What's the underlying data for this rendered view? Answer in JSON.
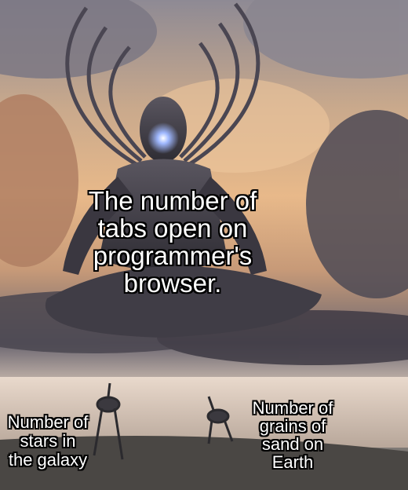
{
  "captions": {
    "main": [
      "The number of",
      "tabs open on",
      "programmer's",
      "browser."
    ],
    "left": [
      "Number of",
      "stars in",
      "the galaxy"
    ],
    "right": [
      "Number of",
      "grains of",
      "sand on",
      "Earth"
    ]
  },
  "colors": {
    "caption_text": "#ffffff",
    "caption_outline": "#000000",
    "eye_glow": "#9fb8ff"
  }
}
